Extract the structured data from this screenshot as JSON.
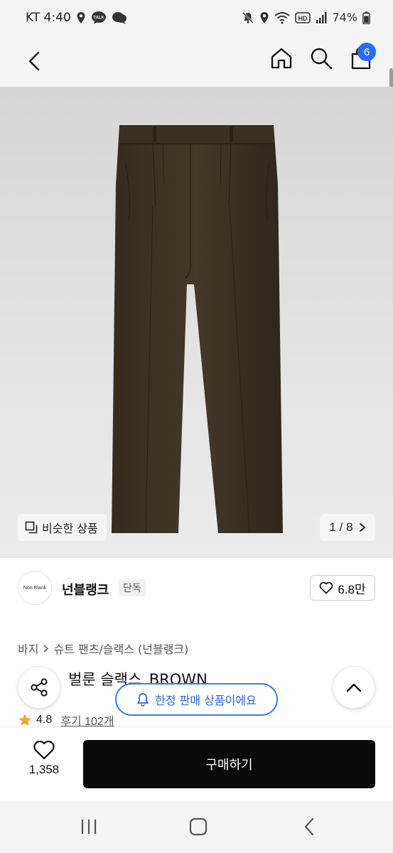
{
  "status_bar": {
    "carrier_time": "KT 4:40",
    "talk_badge": "TALK",
    "hd_badge": "HD",
    "battery": "74%"
  },
  "nav": {
    "cart_count": "6"
  },
  "gallery": {
    "similar_label": "비슷한 상품",
    "page_counter": "1 / 8"
  },
  "brand": {
    "logo_text": "Non Blank",
    "name": "넌블랭크",
    "tag": "단독",
    "likes": "6.8만"
  },
  "product": {
    "breadcrumb": [
      "바지",
      "슈트 팬츠/슬랙스 (넌블랭크)"
    ],
    "title": "벌룬 슬랙스_BROWN",
    "rating": "4.8",
    "reviews": "후기 102개",
    "product_color": "#3e3426"
  },
  "toast": {
    "text": "한정 판매 상품이에요"
  },
  "bottom_bar": {
    "wish_count": "1,358",
    "buy_label": "구매하기"
  },
  "colors": {
    "accent_blue": "#2a6bff",
    "buy_button": "#0a0a0a",
    "star": "#f5a623"
  },
  "icons": {
    "status": [
      "location-pin-icon",
      "talk-bubble-icon",
      "chat-icon",
      "mute-icon",
      "location-icon",
      "wifi-icon",
      "hd-icon",
      "signal-icon",
      "battery-icon"
    ],
    "nav": [
      "back-arrow-icon",
      "home-icon",
      "search-icon",
      "shopping-bag-icon"
    ]
  }
}
